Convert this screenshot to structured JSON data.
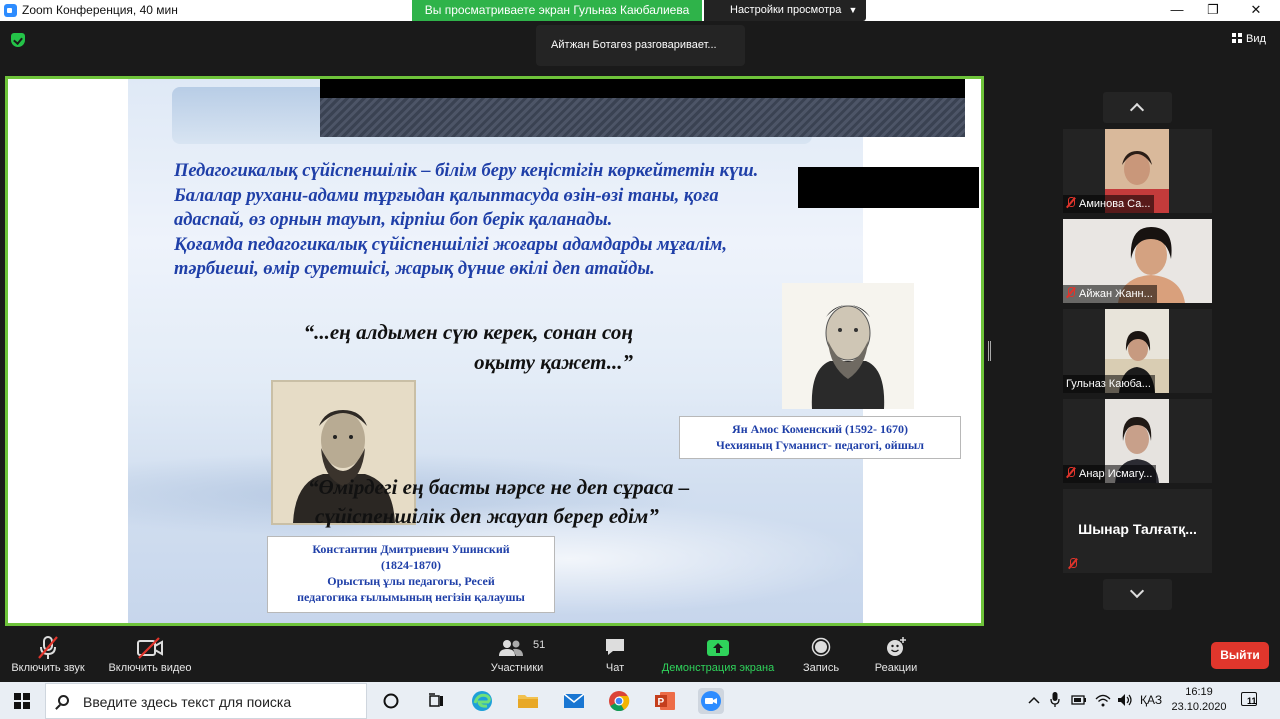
{
  "window": {
    "title": "Zoom Конференция, 40 мин",
    "share_banner": "Вы просматриваете экран Гульназ Каюбалиева",
    "view_settings": "Настройки просмотра",
    "minimize": "—",
    "maximize": "❐",
    "close": "✕"
  },
  "top": {
    "speaker_notice": "Айтжан Ботагөз разговаривает...",
    "view_label": "Вид"
  },
  "slide": {
    "paragraph_lines": [
      "Педагогикалық сүйіспеншілік – білім беру кеңістігін көркейтетін күш.",
      "Балалар рухани-адами тұрғыдан қалыптасуда өзін-өзі таны, қоға",
      "адаспай, өз орнын тауып, кірпіш боп берік қаланады.",
      "Қоғамда   педагогикалық   сүйіспеншілігі   жоғары   адамдарды   мұғалім,",
      "тәрбиеші, өмір суретшісі, жарық дүние өкілі деп атайды."
    ],
    "quote1_line1": "“...ең алдымен сүю керек, сонан соң",
    "quote1_line2": "оқыту қажет...”",
    "quote2_line1": "“Өмірдегі ең басты нәрсе не деп сұраса –",
    "quote2_line2": "сүйіспеншілік деп жауап берер едім”",
    "caption_komensky_1": "Ян Амос Коменский (1592- 1670)",
    "caption_komensky_2": "Чехияның Гуманист- педагогі, ойшыл",
    "caption_ushinsky_1": "Константин Дмитриевич Ушинский",
    "caption_ushinsky_2": "(1824-1870)",
    "caption_ushinsky_3": "Орыстың ұлы педагогы, Ресей",
    "caption_ushinsky_4": "педагогика ғылымының негізін қалаушы"
  },
  "participants": [
    {
      "name": "Аминова Са...",
      "muted": true
    },
    {
      "name": "Айжан Жанн...",
      "muted": true
    },
    {
      "name": "Гульназ Каюба...",
      "muted": false
    },
    {
      "name": "Анар Исмагу...",
      "muted": true
    },
    {
      "name": "Шынар Талғатқ...",
      "muted": true
    }
  ],
  "toolbar": {
    "unmute": "Включить звук",
    "start_video": "Включить видео",
    "participants": "Участники",
    "participants_count": "51",
    "chat": "Чат",
    "share_screen": "Демонстрация экрана",
    "record": "Запись",
    "reactions": "Реакции",
    "exit": "Выйти"
  },
  "taskbar": {
    "search_placeholder": "Введите здесь текст для поиска",
    "language": "ҚАЗ",
    "time": "16:19",
    "date": "23.10.2020",
    "notification_count": "11"
  },
  "colors": {
    "share_green": "#2fb34a",
    "exit_red": "#e0362c",
    "slide_text_blue": "#1f3fa8",
    "muted_red": "#e0342b"
  }
}
